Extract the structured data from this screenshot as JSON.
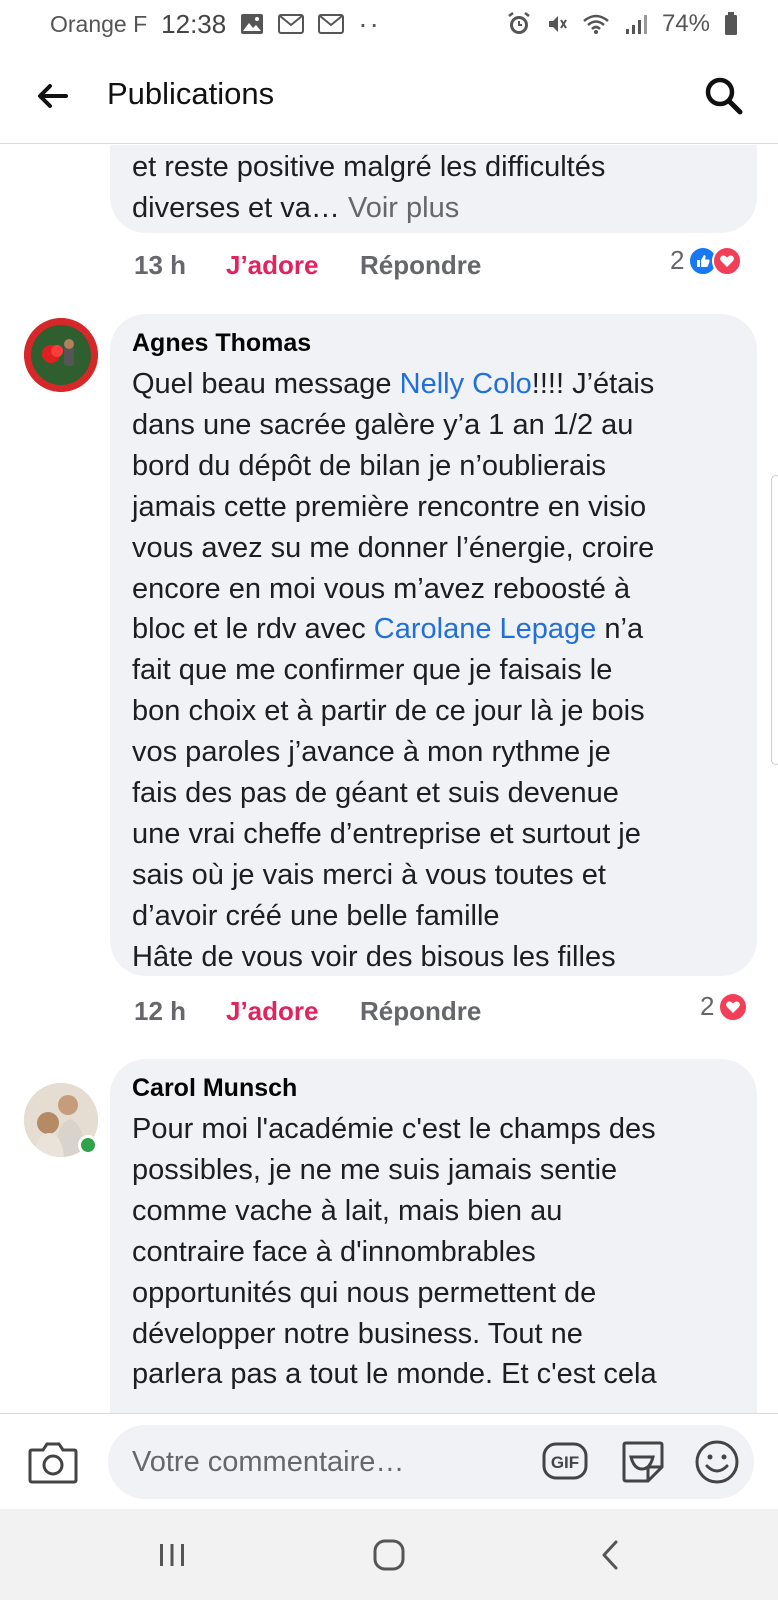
{
  "status_bar": {
    "carrier": "Orange F",
    "time": "12:38",
    "dots": "··",
    "battery": "74%"
  },
  "header": {
    "title": "Publications"
  },
  "comments": [
    {
      "lines": [
        [
          {
            "t": "et reste positive malgré les difficultés"
          }
        ],
        [
          {
            "t": "diverses et va… "
          },
          {
            "t": "Voir plus",
            "k": "see-more"
          }
        ]
      ],
      "time": "13 h",
      "love_label": "J’adore",
      "reply_label": "Répondre",
      "reaction_count": "2",
      "reactions": [
        "like-icon",
        "heart-icon"
      ]
    },
    {
      "author": "Agnes Thomas",
      "lines": [
        [
          {
            "t": "Quel beau message "
          },
          {
            "t": "Nelly Colo",
            "k": "mention"
          },
          {
            "t": "!!!! J’étais"
          }
        ],
        [
          {
            "t": "dans une sacrée galère y’a 1 an 1/2 au"
          }
        ],
        [
          {
            "t": "bord du dépôt de bilan je n’oublierais"
          }
        ],
        [
          {
            "t": "jamais cette première rencontre en visio"
          }
        ],
        [
          {
            "t": "vous avez su me donner l’énergie, croire"
          }
        ],
        [
          {
            "t": "encore en moi vous m’avez reboosté à"
          }
        ],
        [
          {
            "t": "bloc et le rdv avec "
          },
          {
            "t": "Carolane Lepage",
            "k": "mention"
          },
          {
            "t": " n’a"
          }
        ],
        [
          {
            "t": "fait que me confirmer que je faisais le"
          }
        ],
        [
          {
            "t": "bon choix et à partir de ce jour là je bois"
          }
        ],
        [
          {
            "t": "vos paroles j’avance à mon rythme je"
          }
        ],
        [
          {
            "t": "fais des pas de géant et suis devenue"
          }
        ],
        [
          {
            "t": "une vrai cheffe d’entreprise et surtout je"
          }
        ],
        [
          {
            "t": "sais où je vais merci à vous toutes et"
          }
        ],
        [
          {
            "t": "d’avoir créé une belle famille"
          }
        ],
        [
          {
            "t": "Hâte de vous voir des bisous les filles"
          }
        ]
      ],
      "time": "12 h",
      "love_label": "J’adore",
      "reply_label": "Répondre",
      "reaction_count": "2",
      "reactions": [
        "heart-icon"
      ]
    },
    {
      "author": "Carol Munsch",
      "online": true,
      "lines": [
        [
          {
            "t": "Pour moi l'académie c'est le champs des"
          }
        ],
        [
          {
            "t": "possibles, je ne me suis jamais sentie"
          }
        ],
        [
          {
            "t": "comme vache à lait, mais bien au"
          }
        ],
        [
          {
            "t": "contraire face à d'innombrables"
          }
        ],
        [
          {
            "t": "opportunités qui nous permettent de"
          }
        ],
        [
          {
            "t": "développer notre business. Tout ne"
          }
        ],
        [
          {
            "t": "parlera pas a tout le monde. Et c'est cela"
          }
        ]
      ]
    }
  ],
  "composer": {
    "placeholder": "Votre commentaire…",
    "gif_label": "GIF"
  },
  "colors": {
    "mention": "#216fdb",
    "love": "#e0245e",
    "bubble": "#f0f2f5",
    "like": "#1877f2",
    "heart": "#f33e58",
    "online": "#31a24c"
  }
}
